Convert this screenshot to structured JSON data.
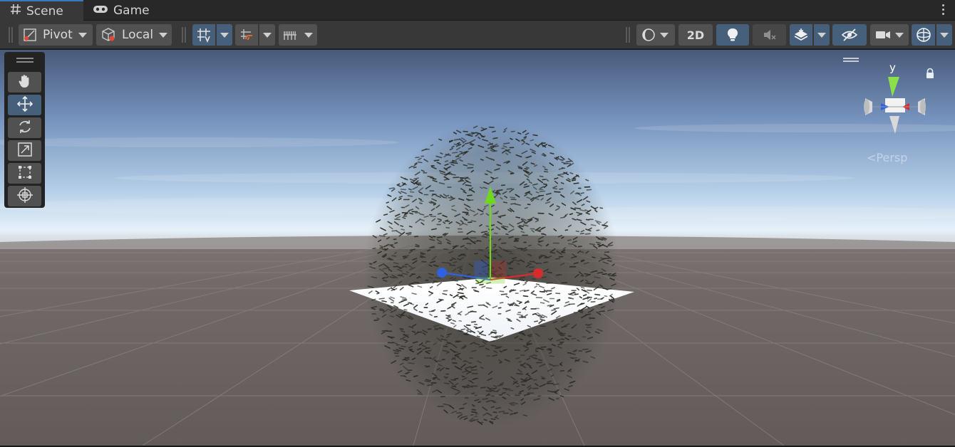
{
  "tabs": [
    {
      "label": "Scene",
      "icon": "hash-icon",
      "active": true
    },
    {
      "label": "Game",
      "icon": "gamepad-icon",
      "active": false
    }
  ],
  "toolbar": {
    "pivot_label": "Pivot",
    "local_label": "Local",
    "toggle_2d_label": "2D"
  },
  "gizmo": {
    "axis_label": "y",
    "projection_label": "Persp"
  },
  "colors": {
    "accent": "#3a79bb",
    "active_button": "#46607c",
    "axis_x": "#d92b2b",
    "axis_y": "#6fd71f",
    "axis_z": "#2f62e0",
    "ground": "#6e6866",
    "sky_top": "#4a5f82",
    "sky_horizon": "#dbe9f6"
  },
  "tools": [
    "hand-tool",
    "move-tool",
    "rotate-tool",
    "scale-tool",
    "rect-tool",
    "transform-tool"
  ]
}
